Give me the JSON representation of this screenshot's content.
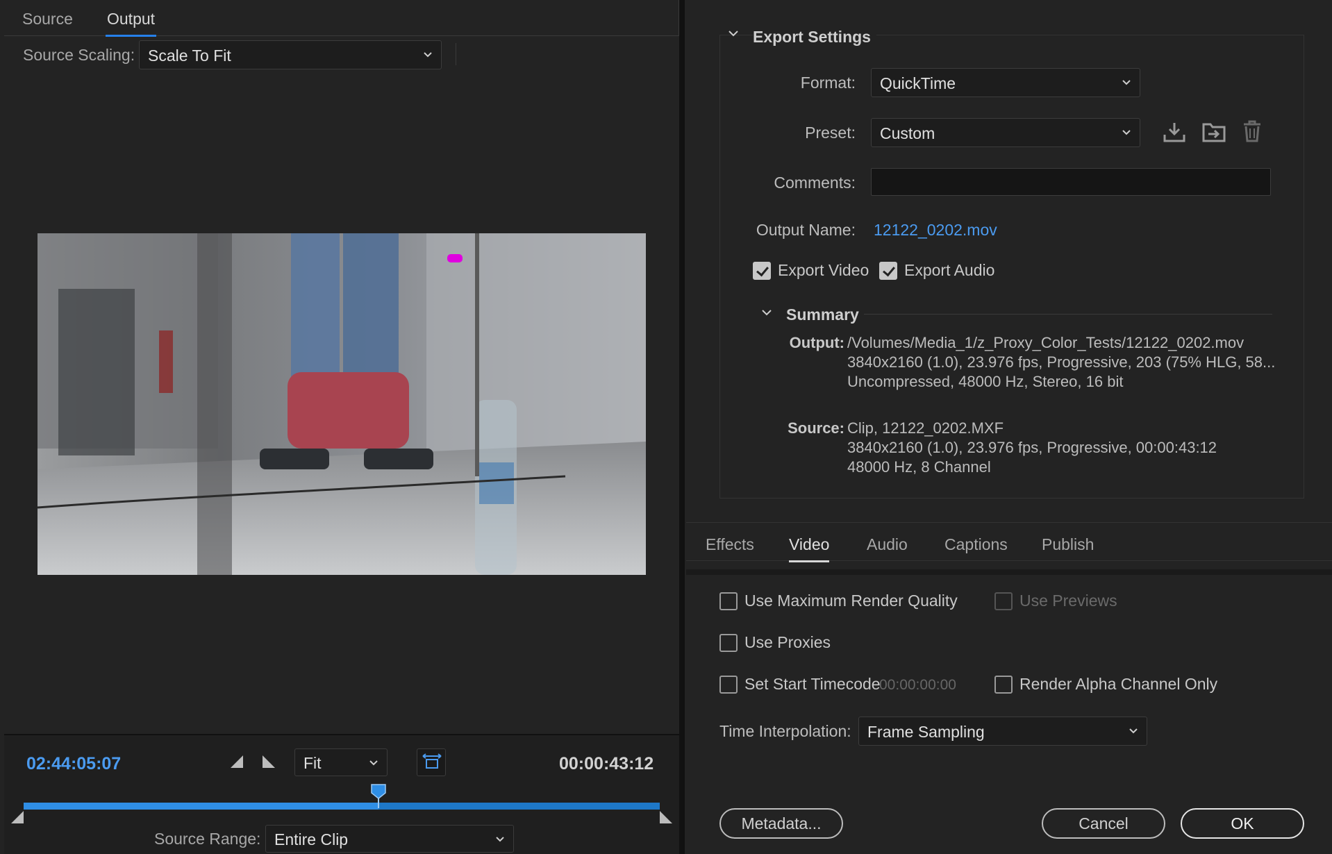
{
  "left_panel": {
    "tabs": [
      {
        "label": "Source"
      },
      {
        "label": "Output"
      }
    ],
    "source_scaling": {
      "label": "Source Scaling:",
      "value": "Scale To Fit"
    },
    "timeline": {
      "current_timecode": "02:44:05:07",
      "duration_timecode": "00:00:43:12",
      "zoom": {
        "value": "Fit"
      },
      "playhead_fraction": 0.558
    },
    "source_range": {
      "label": "Source Range:",
      "value": "Entire Clip"
    }
  },
  "export_settings": {
    "title": "Export Settings",
    "format": {
      "label": "Format:",
      "value": "QuickTime"
    },
    "preset": {
      "label": "Preset:",
      "value": "Custom"
    },
    "comments": {
      "label": "Comments:",
      "value": ""
    },
    "output_name": {
      "label": "Output Name:",
      "value": "12122_0202.mov"
    },
    "export_video": {
      "label": "Export Video",
      "checked": true
    },
    "export_audio": {
      "label": "Export Audio",
      "checked": true
    },
    "summary": {
      "title": "Summary",
      "output_label": "Output:",
      "output_lines": [
        "/Volumes/Media_1/z_Proxy_Color_Tests/12122_0202.mov",
        "3840x2160 (1.0), 23.976 fps, Progressive, 203 (75% HLG, 58...",
        "Uncompressed, 48000 Hz, Stereo, 16 bit"
      ],
      "source_label": "Source:",
      "source_lines": [
        "Clip, 12122_0202.MXF",
        "3840x2160 (1.0), 23.976 fps, Progressive, 00:00:43:12",
        "48000 Hz, 8 Channel"
      ]
    }
  },
  "settings_tabs": [
    {
      "label": "Effects"
    },
    {
      "label": "Video"
    },
    {
      "label": "Audio"
    },
    {
      "label": "Captions"
    },
    {
      "label": "Publish"
    }
  ],
  "video_options": {
    "max_render_quality": {
      "label": "Use Maximum Render Quality",
      "checked": false
    },
    "use_previews": {
      "label": "Use Previews",
      "checked": false,
      "disabled": true
    },
    "use_proxies": {
      "label": "Use Proxies",
      "checked": false
    },
    "set_start_timecode": {
      "label": "Set Start Timecode",
      "checked": false,
      "timecode": "00:00:00:00"
    },
    "render_alpha": {
      "label": "Render Alpha Channel Only",
      "checked": false
    },
    "time_interpolation": {
      "label": "Time Interpolation:",
      "value": "Frame Sampling"
    }
  },
  "footer": {
    "metadata": "Metadata...",
    "cancel": "Cancel",
    "ok": "OK"
  }
}
